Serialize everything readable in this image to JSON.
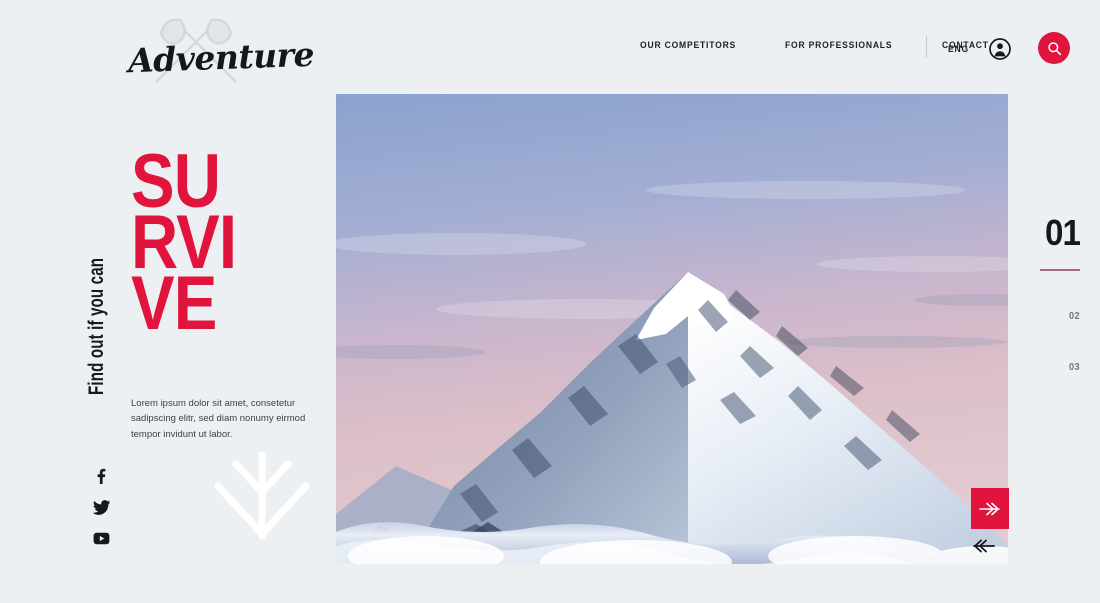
{
  "brand": {
    "name": "Adventure",
    "logo_icon": "crossed-axes-icon"
  },
  "header": {
    "nav": [
      {
        "label": "OUR COMPETITORS"
      },
      {
        "label": "FOR PROFESSIONALS"
      },
      {
        "label": "CONTACT"
      }
    ],
    "language": "ENG",
    "account_icon": "user-circle-icon",
    "search_icon": "search-icon",
    "accent_color": "#e0143c"
  },
  "hero": {
    "kicker": "Find out if you can",
    "headline_lines": [
      "SU",
      "RVI",
      "VE"
    ],
    "headline_color": "#e0143c",
    "paragraph": "Lorem ipsum dolor sit amet, consetetur sadipscing elitr, sed diam nonumy eirmod tempor invidunt ut labor.",
    "scroll_icon": "double-chevron-down-icon",
    "image_alt": "Snow-capped mountain peak above clouds at sunset"
  },
  "socials": [
    {
      "name": "facebook",
      "glyph": "f"
    },
    {
      "name": "twitter",
      "glyph": "twitter-bird"
    },
    {
      "name": "youtube",
      "glyph": "youtube-play"
    }
  ],
  "carousel": {
    "active": "01",
    "slides": [
      "01",
      "02",
      "03"
    ],
    "indicator_rule_color": "#a76a86",
    "next_icon": "double-chevron-right-icon",
    "prev_icon": "double-chevron-left-icon"
  },
  "theme": {
    "background": "#edf0f3",
    "text_dark": "#15181c",
    "text_muted": "#6e757d"
  }
}
